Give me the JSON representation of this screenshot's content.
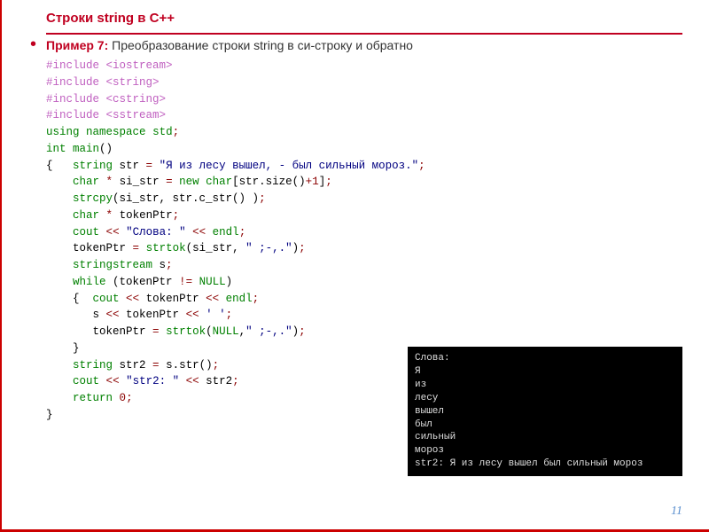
{
  "title": "Строки  string в С++",
  "subtitle_prefix": "Пример 7:",
  "subtitle_text": " Преобразование строки string в си-строку и обратно",
  "code_lines": [
    {
      "t": "pp",
      "raw": "#include <iostream>"
    },
    {
      "t": "pp",
      "raw": "#include <string>"
    },
    {
      "t": "pp",
      "raw": "#include <cstring>"
    },
    {
      "t": "pp",
      "raw": "#include <sstream>"
    },
    {
      "t": "using",
      "raw": "using namespace std;"
    },
    {
      "t": "intmain",
      "raw": "int main()"
    },
    {
      "t": "brace",
      "raw": "{   string str = \"Я из лесу вышел, - был сильный мороз.\";"
    },
    {
      "t": "line",
      "raw": "    char * si_str = new char[str.size()+1];"
    },
    {
      "t": "line",
      "raw": "    strcpy(si_str, str.c_str() );"
    },
    {
      "t": "line",
      "raw": "    char * tokenPtr;"
    },
    {
      "t": "line",
      "raw": "    cout << \"Слова: \" << endl;"
    },
    {
      "t": "line",
      "raw": "    tokenPtr = strtok(si_str, \" ;-,.\");"
    },
    {
      "t": "line",
      "raw": "    stringstream s;"
    },
    {
      "t": "line",
      "raw": "    while (tokenPtr != NULL)"
    },
    {
      "t": "line",
      "raw": "    {  cout << tokenPtr << endl;"
    },
    {
      "t": "line",
      "raw": "       s << tokenPtr << ' ';"
    },
    {
      "t": "line",
      "raw": "       tokenPtr = strtok(NULL,\" ;-,.\");"
    },
    {
      "t": "line",
      "raw": "    }"
    },
    {
      "t": "line",
      "raw": "    string str2 = s.str();"
    },
    {
      "t": "line",
      "raw": "    cout << \"str2: \" << str2;"
    },
    {
      "t": "line",
      "raw": "    return 0;"
    },
    {
      "t": "line",
      "raw": "}"
    }
  ],
  "console_output": "Слова:\nЯ\nиз\nлесу\nвышел\nбыл\nсильный\nмороз\nstr2: Я из лесу вышел был сильный мороз",
  "page_number": "11"
}
